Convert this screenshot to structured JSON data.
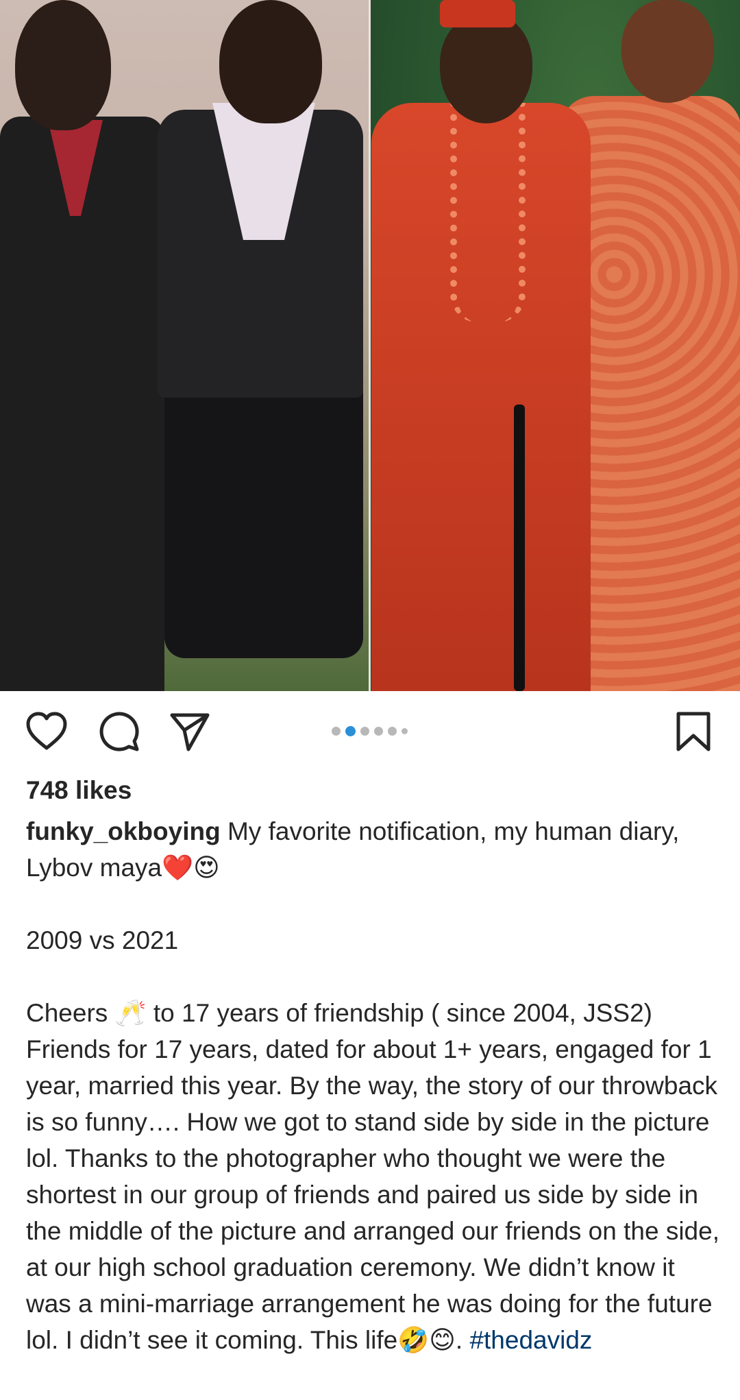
{
  "post": {
    "likes_text": "748 likes",
    "username": "funky_okboying",
    "caption_text": " My favorite notification, my human diary, Lybov maya❤️😍\n\n2009 vs 2021\n\nCheers 🥂 to 17 years of friendship ( since 2004, JSS2) Friends for 17 years, dated for about 1+ years, engaged for 1 year, married this year. By the way, the story of our throwback is so funny…. How we got to stand side by side in the picture lol. Thanks to the photographer who thought we were the shortest in our group of friends and paired us side by side in the middle of the picture and arranged our friends on the side, at our high school graduation ceremony. We didn’t know it was a mini-marriage arrangement he was doing for the future lol. I didn’t see it coming. This life🤣😊. ",
    "hashtag": "#thedavidz"
  },
  "carousel": {
    "total": 6,
    "active_index": 1
  },
  "icons": {
    "like": "heart-icon",
    "comment": "comment-icon",
    "share": "share-icon",
    "save": "bookmark-icon"
  },
  "colors": {
    "text": "#262626",
    "hashtag": "#00376b",
    "active_dot": "#2b8fd8",
    "inactive_dot": "#b8b8b8"
  }
}
